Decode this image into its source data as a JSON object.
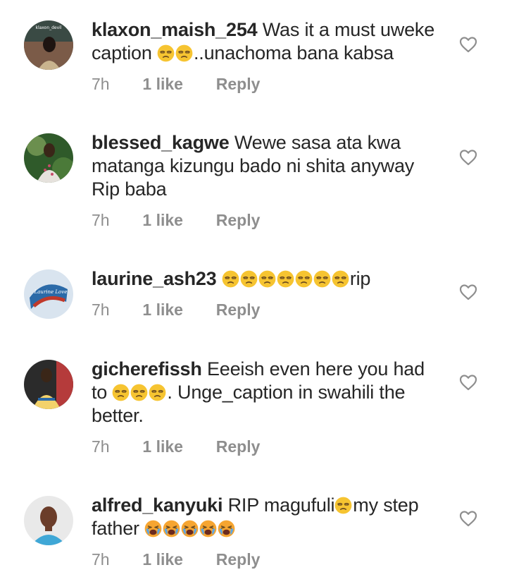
{
  "comments": [
    {
      "username": "klaxon_maish_254",
      "text1": "Was it a must uweke",
      "text2": "caption",
      "emoji_run": [
        "unamused-face",
        "unamused-face"
      ],
      "text3": "..unachoma bana kabsa",
      "time": "7h",
      "likes": "1 like",
      "reply": "Reply",
      "avatar_lettering": "klaxon_devil",
      "avatar_colors": [
        "#3a4a44",
        "#7b5b48",
        "#c9b48e"
      ]
    },
    {
      "username": "blessed_kagwe",
      "line1": "Wewe sasa ata kwa",
      "line2": "matanga kizungu bado ni shita anyway",
      "line3": "Rip baba",
      "time": "7h",
      "likes": "1 like",
      "reply": "Reply",
      "avatar_colors": [
        "#2f5a2a",
        "#6b8f4e",
        "#e6e2dd"
      ]
    },
    {
      "username": "laurine_ash23",
      "emoji_run": [
        "unamused-face",
        "unamused-face",
        "unamused-face",
        "unamused-face",
        "unamused-face",
        "unamused-face",
        "unamused-face"
      ],
      "tail": "rip",
      "time": "7h",
      "likes": "1 like",
      "reply": "Reply",
      "avatar_lettering": "Laurine Love",
      "avatar_colors": [
        "#d9e4ef",
        "#2b6aa8",
        "#c0392b"
      ]
    },
    {
      "username": "gicherefissh",
      "text1": "Eeeish even here you had",
      "text2_prefix": "to ",
      "emoji_run": [
        "unamused-face",
        "unamused-face",
        "unamused-face"
      ],
      "text2_suffix": ". Unge_caption in swahili the",
      "text3": "better.",
      "time": "7h",
      "likes": "1 like",
      "reply": "Reply",
      "avatar_colors": [
        "#2b2b2b",
        "#b53b3b",
        "#f3d26b"
      ]
    },
    {
      "username": "alfred_kanyuki",
      "text1": "RIP magufuli",
      "emoji_mid": [
        "unamused-face"
      ],
      "text1_tail": "my step",
      "text2": "father",
      "emoji_run": [
        "loudly-crying-face",
        "loudly-crying-face",
        "loudly-crying-face",
        "loudly-crying-face",
        "loudly-crying-face"
      ],
      "time": "7h",
      "likes": "1 like",
      "reply": "Reply",
      "avatar_colors": [
        "#e9e9e9",
        "#6b3d2a",
        "#3fa7d6"
      ]
    }
  ],
  "colors": {
    "text": "#262626",
    "meta": "#8e8e8e",
    "emoji_face": "#f6c431",
    "emoji_feature": "#6b4b1f",
    "tear": "#5aa6e8",
    "heart_outline": "#8e8e8e"
  },
  "icons": {
    "like": "heart-outline-icon",
    "emoji_unamused": "unamused-face",
    "emoji_crying": "loudly-crying-face"
  }
}
